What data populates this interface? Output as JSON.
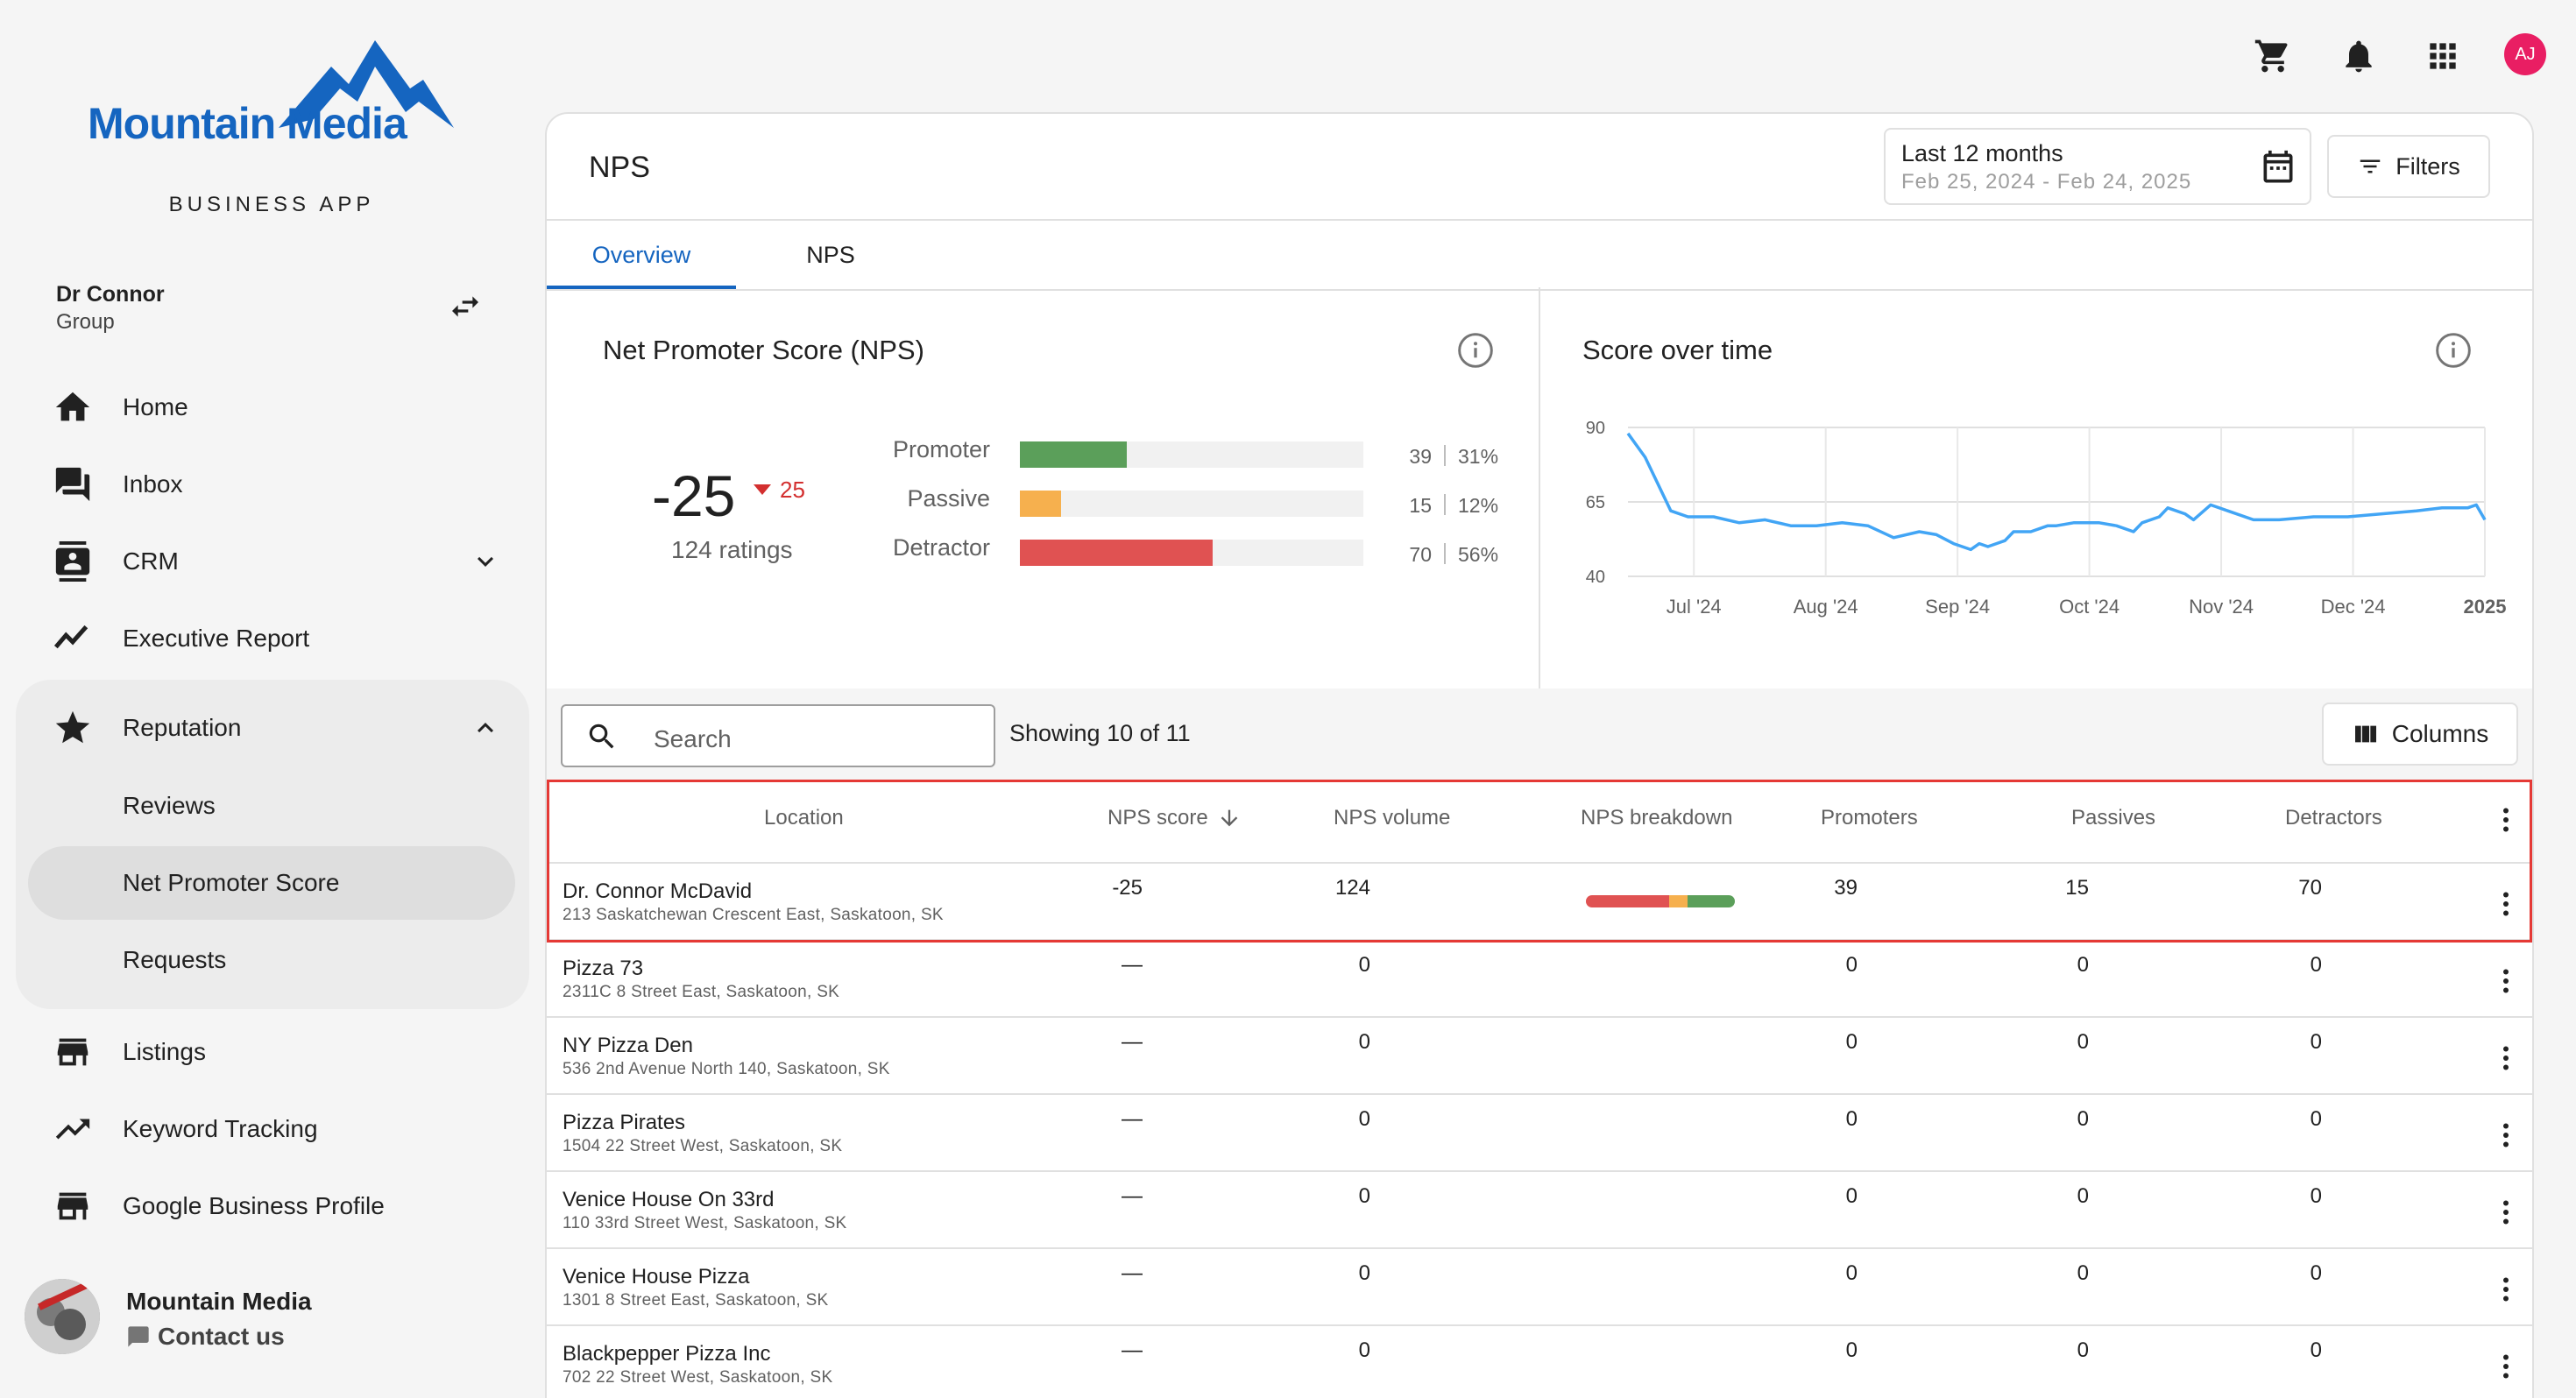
{
  "brand": {
    "name": "Mountain Media",
    "subtitle": "BUSINESS APP"
  },
  "account": {
    "name": "Dr Connor",
    "type": "Group"
  },
  "nav": {
    "home": "Home",
    "inbox": "Inbox",
    "crm": "CRM",
    "executive_report": "Executive Report",
    "reputation": "Reputation",
    "reviews": "Reviews",
    "net_promoter_score": "Net Promoter Score",
    "requests": "Requests",
    "listings": "Listings",
    "keyword_tracking": "Keyword Tracking",
    "google_business_profile": "Google Business Profile"
  },
  "footer": {
    "name": "Mountain Media",
    "contact": "Contact us"
  },
  "topbar": {
    "avatar_initials": "AJ"
  },
  "page": {
    "title": "NPS",
    "date_range": {
      "label": "Last 12 months",
      "range": "Feb 25, 2024 - Feb 24, 2025"
    },
    "filters": "Filters",
    "tabs": [
      "Overview",
      "NPS"
    ]
  },
  "nps_panel": {
    "title": "Net Promoter Score (NPS)",
    "score": "-25",
    "delta": "25",
    "ratings": "124 ratings",
    "breakdown": [
      {
        "label": "Promoter",
        "count": "39",
        "pct": "31%",
        "fraction": 0.31,
        "color": "#5b9f5a"
      },
      {
        "label": "Passive",
        "count": "15",
        "pct": "12%",
        "fraction": 0.12,
        "color": "#f6b04e"
      },
      {
        "label": "Detractor",
        "count": "70",
        "pct": "56%",
        "fraction": 0.56,
        "color": "#e05252"
      }
    ]
  },
  "chart_panel": {
    "title": "Score over time"
  },
  "chart_data": {
    "type": "line",
    "title": "Score over time",
    "yticks": [
      "90",
      "65",
      "40"
    ],
    "ylim": [
      40,
      90
    ],
    "xticks": [
      "Jul '24",
      "Aug '24",
      "Sep '24",
      "Oct '24",
      "Nov '24",
      "Dec '24",
      "2025"
    ],
    "grid": true,
    "series": [
      {
        "color": "#42a5f5",
        "x": [
          0,
          0.02,
          0.05,
          0.07,
          0.1,
          0.13,
          0.16,
          0.19,
          0.22,
          0.25,
          0.28,
          0.31,
          0.34,
          0.36,
          0.38,
          0.4,
          0.41,
          0.42,
          0.43,
          0.44,
          0.45,
          0.47,
          0.49,
          0.5,
          0.52,
          0.55,
          0.57,
          0.59,
          0.6,
          0.62,
          0.63,
          0.65,
          0.66,
          0.68,
          0.7,
          0.73,
          0.76,
          0.8,
          0.84,
          0.88,
          0.92,
          0.95,
          0.98,
          0.99,
          1.0
        ],
        "y": [
          88,
          80,
          62,
          60,
          60,
          58,
          59,
          57,
          57,
          58,
          57,
          53,
          55,
          54,
          51,
          49,
          51,
          50,
          51,
          52,
          55,
          55,
          57,
          57,
          58,
          58,
          57,
          55,
          58,
          60,
          63,
          61,
          59,
          64,
          62,
          59,
          59,
          60,
          60,
          61,
          62,
          63,
          63,
          64,
          59
        ]
      }
    ]
  },
  "toolbar": {
    "search_placeholder": "Search",
    "showing": "Showing 10 of 11",
    "columns": "Columns"
  },
  "table": {
    "headers": {
      "location": "Location",
      "nps_score": "NPS score",
      "nps_volume": "NPS volume",
      "nps_breakdown": "NPS breakdown",
      "promoters": "Promoters",
      "passives": "Passives",
      "detractors": "Detractors"
    },
    "rows": [
      {
        "name": "Dr. Connor McDavid",
        "address": "213 Saskatchewan Crescent East, Saskatoon, SK",
        "score": "-25",
        "volume": "124",
        "promoters": "39",
        "passives": "15",
        "detractors": "70"
      },
      {
        "name": "Pizza 73",
        "address": "2311C 8 Street East, Saskatoon, SK",
        "score": "—",
        "volume": "0",
        "promoters": "0",
        "passives": "0",
        "detractors": "0"
      },
      {
        "name": "NY Pizza Den",
        "address": "536 2nd Avenue North 140, Saskatoon, SK",
        "score": "—",
        "volume": "0",
        "promoters": "0",
        "passives": "0",
        "detractors": "0"
      },
      {
        "name": "Pizza Pirates",
        "address": "1504 22 Street West, Saskatoon, SK",
        "score": "—",
        "volume": "0",
        "promoters": "0",
        "passives": "0",
        "detractors": "0"
      },
      {
        "name": "Venice House On 33rd",
        "address": "110 33rd Street West, Saskatoon, SK",
        "score": "—",
        "volume": "0",
        "promoters": "0",
        "passives": "0",
        "detractors": "0"
      },
      {
        "name": "Venice House Pizza",
        "address": "1301 8 Street East, Saskatoon, SK",
        "score": "—",
        "volume": "0",
        "promoters": "0",
        "passives": "0",
        "detractors": "0"
      },
      {
        "name": "Blackpepper Pizza Inc",
        "address": "702 22 Street West, Saskatoon, SK",
        "score": "—",
        "volume": "0",
        "promoters": "0",
        "passives": "0",
        "detractors": "0"
      }
    ]
  },
  "colors": {
    "accent": "#1565c0",
    "highlight": "#e53935",
    "promoter": "#5b9f5a",
    "passive": "#f6b04e",
    "detractor": "#e05252"
  }
}
